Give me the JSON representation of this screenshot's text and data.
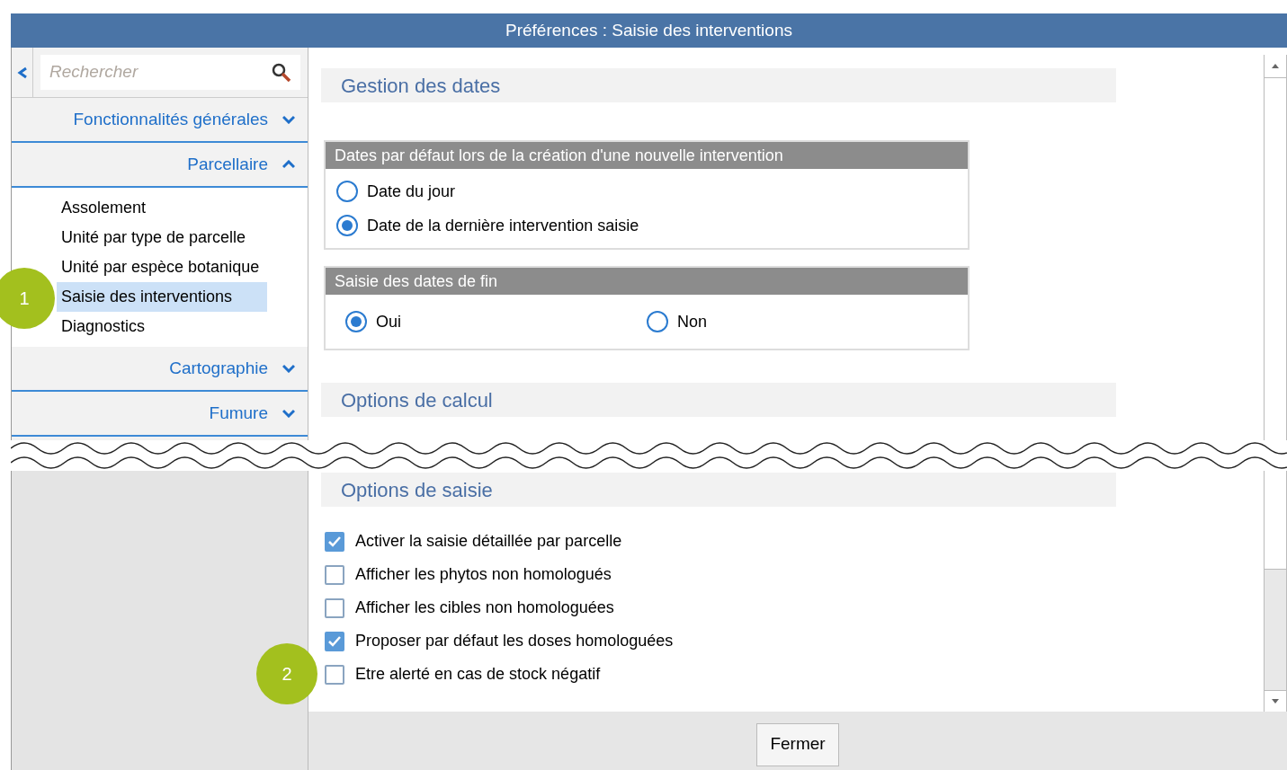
{
  "window": {
    "title": "Préférences : Saisie des interventions"
  },
  "sidebar": {
    "search": {
      "placeholder": "Rechercher"
    },
    "sections": [
      {
        "label": "Fonctionnalités générales",
        "expanded": false
      },
      {
        "label": "Parcellaire",
        "expanded": true,
        "items": [
          {
            "label": "Assolement",
            "selected": false
          },
          {
            "label": "Unité par type de parcelle",
            "selected": false
          },
          {
            "label": "Unité par espèce botanique",
            "selected": false
          },
          {
            "label": "Saisie des interventions",
            "selected": true,
            "callout": "1"
          },
          {
            "label": "Diagnostics",
            "selected": false
          }
        ]
      },
      {
        "label": "Cartographie",
        "expanded": false
      },
      {
        "label": "Fumure",
        "expanded": false
      }
    ]
  },
  "sections": [
    {
      "title": "Gestion des dates",
      "groups": [
        {
          "title": "Dates par défaut lors de la création d'une nouvelle intervention",
          "kind": "stacked",
          "options": [
            {
              "label": "Date du jour",
              "selected": false
            },
            {
              "label": "Date de la dernière intervention saisie",
              "selected": true
            }
          ]
        },
        {
          "title": "Saisie des dates de fin",
          "kind": "inline",
          "options": [
            {
              "label": "Oui",
              "selected": true
            },
            {
              "label": "Non",
              "selected": false
            }
          ]
        }
      ]
    },
    {
      "title": "Options de calcul"
    }
  ],
  "bottom_section": {
    "title": "Options de saisie",
    "options": [
      {
        "label": "Activer la saisie détaillée par parcelle",
        "checked": true
      },
      {
        "label": "Afficher les phytos non homologués",
        "checked": false
      },
      {
        "label": "Afficher les cibles non homologuées",
        "checked": false
      },
      {
        "label": "Proposer par défaut les doses homologuées",
        "checked": true
      },
      {
        "label": "Etre alerté en cas de stock négatif",
        "checked": false,
        "callout": "2"
      }
    ]
  },
  "buttons": [
    {
      "label": "Fermer"
    }
  ]
}
